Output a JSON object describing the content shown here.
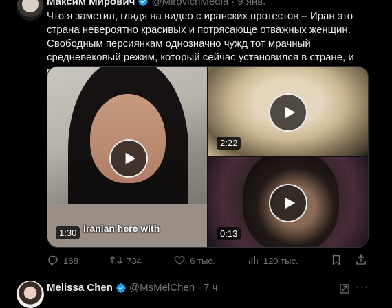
{
  "tweet": {
    "author_name": "Максим Мирович",
    "handle": "@MirovichMedia",
    "separator": "·",
    "date": "9 янв.",
    "text": "Что я заметил, глядя на видео с иранских протестов – Иран это страна невероятно красивых и потрясающе отважных женщин. Свободным персиянкам однозначно чужд тот мрачный средневековый режим, который сейчас установился в стране, и рано или поздно они его одолеют.",
    "media": [
      {
        "duration": "1:30",
        "caption": "Iranian here with"
      },
      {
        "duration": "2:22"
      },
      {
        "duration": "0:13"
      }
    ],
    "actions": {
      "replies": "168",
      "reposts": "734",
      "likes": "6 тыс.",
      "views": "120 тыс."
    }
  },
  "next_tweet": {
    "author_name": "Melissa Chen",
    "handle": "@MsMelChen",
    "separator": "·",
    "date": "7 ч"
  },
  "colors": {
    "background": "#000000",
    "text": "#e7e9ea",
    "muted": "#71767b",
    "verified": "#1d9bf0",
    "border": "#2f3336"
  }
}
